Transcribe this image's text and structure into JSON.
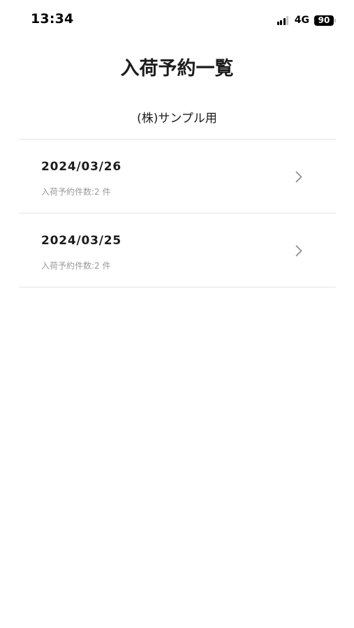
{
  "status_bar": {
    "time": "13:34",
    "network": "4G",
    "battery": "90",
    "icons": [
      "signal-icon",
      "battery-icon"
    ]
  },
  "header": {
    "title": "入荷予約一覧",
    "company": "(株)サンプル用"
  },
  "list": {
    "items": [
      {
        "date": "2024/03/26",
        "count": "入荷予約件数:2 件"
      },
      {
        "date": "2024/03/25",
        "count": "入荷予約件数:2 件"
      }
    ]
  },
  "colors": {
    "text": "#1c1c1e",
    "subtext": "#9a9a9e",
    "divider": "#e4e4e6",
    "chevron": "#8e8e93"
  }
}
